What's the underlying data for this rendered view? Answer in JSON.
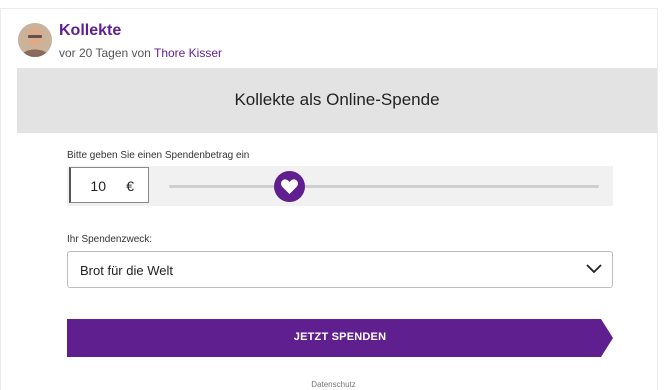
{
  "post": {
    "title": "Kollekte",
    "meta_prefix": "vor 20 Tagen von",
    "author": "Thore Kisser"
  },
  "widget": {
    "banner_title": "Kollekte als Online-Spende",
    "amount_label": "Bitte geben Sie einen Spendenbetrag ein",
    "amount_value": "10",
    "currency": "€",
    "slider_icon": "heart-icon",
    "purpose_label": "Ihr Spendenzweck:",
    "purpose_selected": "Brot für die Welt",
    "donate_label": "JETZT SPENDEN",
    "privacy_link": "Datenschutz"
  },
  "colors": {
    "brand_purple": "#5f1f8f",
    "banner_bg": "#e3e3e3"
  }
}
